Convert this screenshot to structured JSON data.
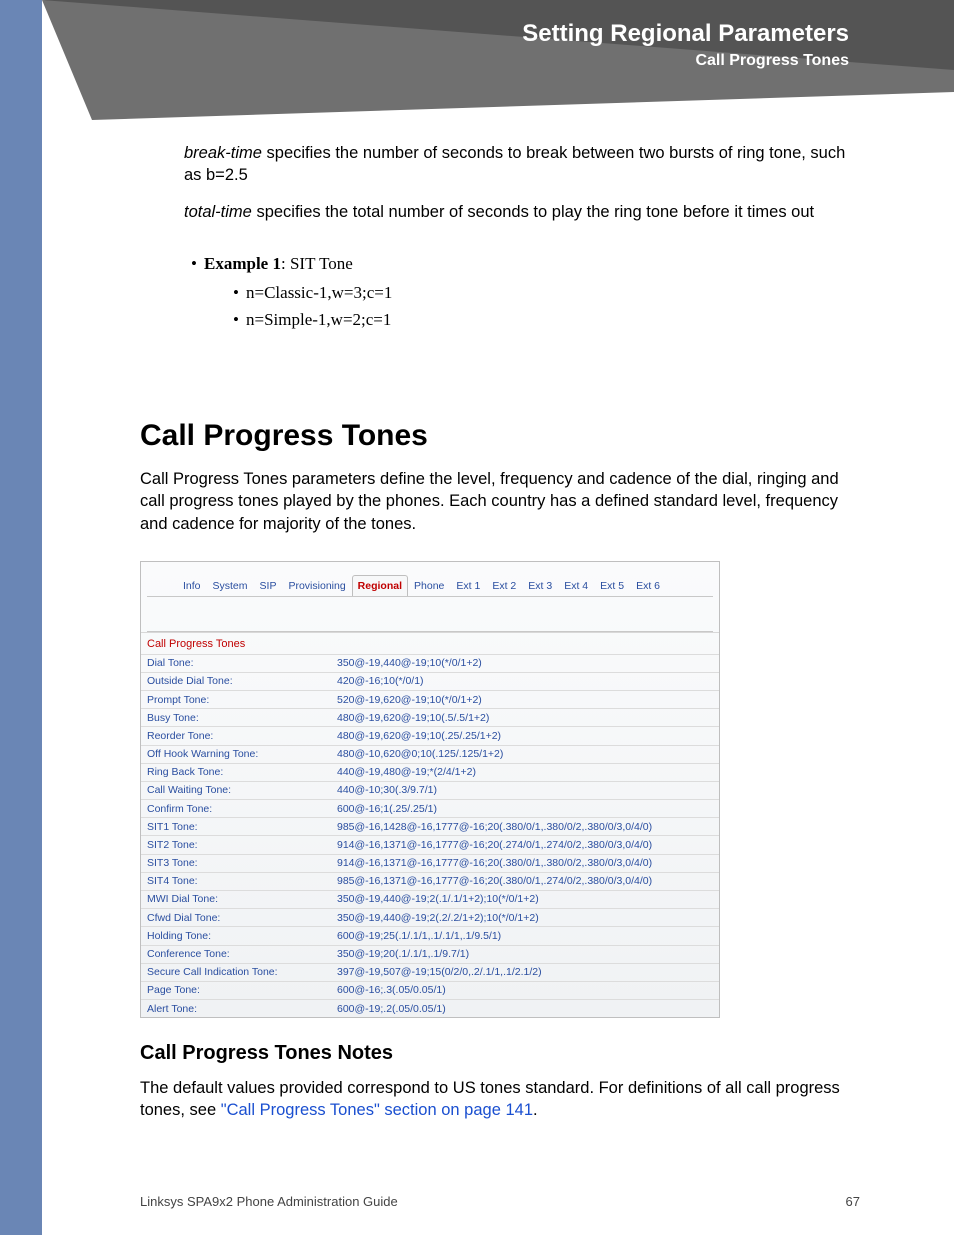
{
  "header": {
    "title": "Setting Regional Parameters",
    "subtitle": "Call Progress Tones"
  },
  "intro": {
    "p1_it": "break-time",
    "p1_rest": " specifies the number of seconds to break between two bursts of ring tone, such as b=2.5",
    "p2_it": "total-time",
    "p2_rest": " specifies the total number of seconds to play the ring tone before it times out"
  },
  "example": {
    "label": "Example 1",
    "tail": ": SIT Tone",
    "items": [
      "n=Classic-1,w=3;c=1",
      "n=Simple-1,w=2;c=1"
    ]
  },
  "section": {
    "h1": "Call Progress Tones",
    "para": "Call Progress Tones parameters define the level, frequency and cadence of the dial, ringing and call progress tones played by the phones. Each country has a defined standard level, frequency and cadence for majority of the tones."
  },
  "tabs": [
    "Info",
    "System",
    "SIP",
    "Provisioning",
    "Regional",
    "Phone",
    "Ext 1",
    "Ext 2",
    "Ext 3",
    "Ext 4",
    "Ext 5",
    "Ext 6"
  ],
  "tabs_active_index": 4,
  "panel_title": "Call Progress Tones",
  "params": [
    {
      "label": "Dial Tone:",
      "value": "350@-19,440@-19;10(*/0/1+2)"
    },
    {
      "label": "Outside Dial Tone:",
      "value": "420@-16;10(*/0/1)"
    },
    {
      "label": "Prompt Tone:",
      "value": "520@-19,620@-19;10(*/0/1+2)"
    },
    {
      "label": "Busy Tone:",
      "value": "480@-19,620@-19;10(.5/.5/1+2)"
    },
    {
      "label": "Reorder Tone:",
      "value": "480@-19,620@-19;10(.25/.25/1+2)"
    },
    {
      "label": "Off Hook Warning Tone:",
      "value": "480@-10,620@0;10(.125/.125/1+2)"
    },
    {
      "label": "Ring Back Tone:",
      "value": "440@-19,480@-19;*(2/4/1+2)"
    },
    {
      "label": "Call Waiting Tone:",
      "value": "440@-10;30(.3/9.7/1)"
    },
    {
      "label": "Confirm Tone:",
      "value": "600@-16;1(.25/.25/1)"
    },
    {
      "label": "SIT1 Tone:",
      "value": "985@-16,1428@-16,1777@-16;20(.380/0/1,.380/0/2,.380/0/3,0/4/0)"
    },
    {
      "label": "SIT2 Tone:",
      "value": "914@-16,1371@-16,1777@-16;20(.274/0/1,.274/0/2,.380/0/3,0/4/0)"
    },
    {
      "label": "SIT3 Tone:",
      "value": "914@-16,1371@-16,1777@-16;20(.380/0/1,.380/0/2,.380/0/3,0/4/0)"
    },
    {
      "label": "SIT4 Tone:",
      "value": "985@-16,1371@-16,1777@-16;20(.380/0/1,.274/0/2,.380/0/3,0/4/0)"
    },
    {
      "label": "MWI Dial Tone:",
      "value": "350@-19,440@-19;2(.1/.1/1+2);10(*/0/1+2)"
    },
    {
      "label": "Cfwd Dial Tone:",
      "value": "350@-19,440@-19;2(.2/.2/1+2);10(*/0/1+2)"
    },
    {
      "label": "Holding Tone:",
      "value": "600@-19;25(.1/.1/1,.1/.1/1,.1/9.5/1)"
    },
    {
      "label": "Conference Tone:",
      "value": "350@-19;20(.1/.1/1,.1/9.7/1)"
    },
    {
      "label": "Secure Call Indication Tone:",
      "value": "397@-19,507@-19;15(0/2/0,.2/.1/1,.1/2.1/2)"
    },
    {
      "label": "Page Tone:",
      "value": "600@-16;.3(.05/0.05/1)"
    },
    {
      "label": "Alert Tone:",
      "value": "600@-19;.2(.05/0.05/1)"
    }
  ],
  "notes": {
    "h2": "Call Progress Tones Notes",
    "text": "The default values provided correspond to US tones standard.  For definitions of all call progress tones, see ",
    "link": "\"Call Progress Tones\" section on page 141",
    "period": "."
  },
  "footer": {
    "left": "Linksys SPA9x2 Phone Administration Guide",
    "right": "67"
  }
}
